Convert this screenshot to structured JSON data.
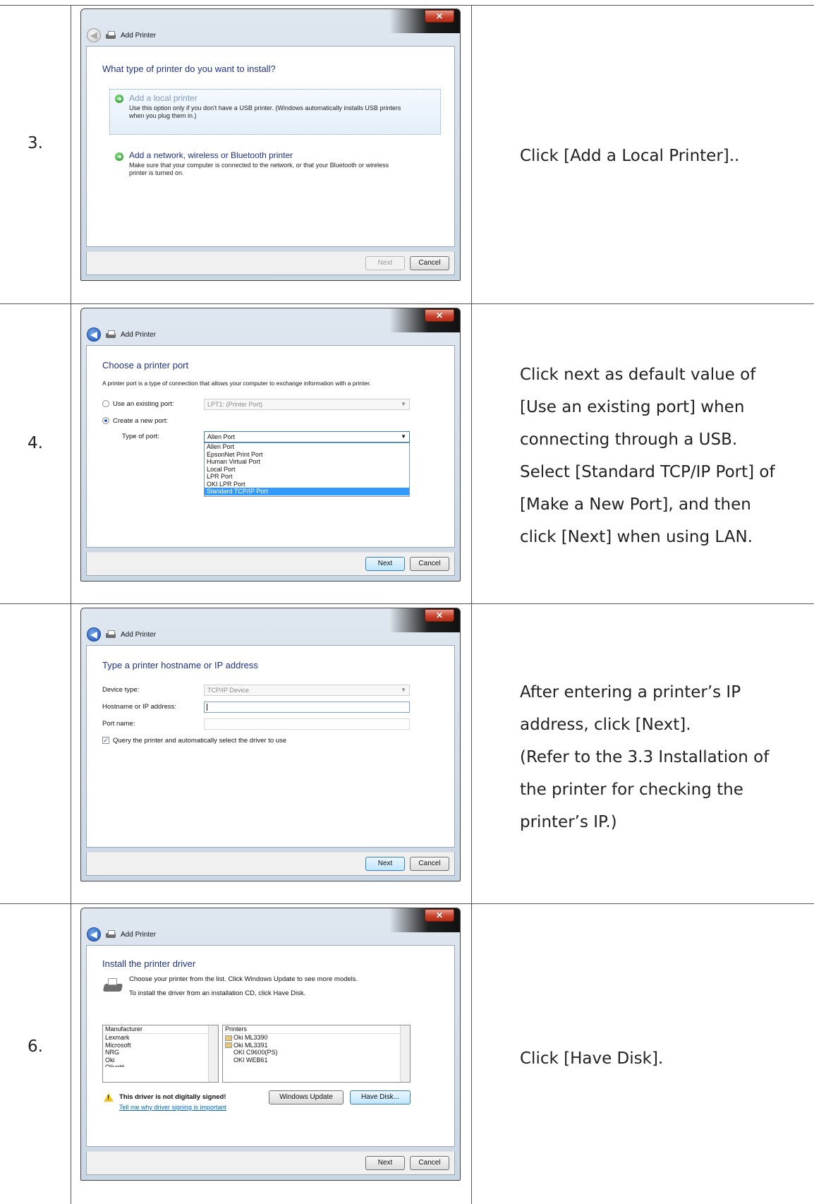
{
  "rows": [
    {
      "number": "3.",
      "instruction": [
        "Click [Add a Local Printer].."
      ],
      "dialog": {
        "title": "Add Printer",
        "heading": "What type of printer do you want to install?",
        "option1_title": "Add a local printer",
        "option1_desc1": "Use this option only if you don't have a USB printer. (Windows automatically installs USB printers",
        "option1_desc2": "when you plug them in.)",
        "option2_title": "Add a network, wireless or Bluetooth printer",
        "option2_desc1": "Make sure that your computer is connected to the network, or that your Bluetooth or wireless",
        "option2_desc2": "printer is turned on.",
        "next_label": "Next",
        "cancel_label": "Cancel"
      }
    },
    {
      "number": "4.",
      "instruction": [
        "Click next as default value of",
        "[Use an existing port] when",
        "connecting through a USB.",
        "Select   [Standard TCP/IP Port] of",
        "[Make a New Port], and then",
        "click [Next] when using LAN."
      ],
      "dialog": {
        "title": "Add Printer",
        "heading": "Choose a printer port",
        "description": "A printer port is a type of connection that allows your computer to exchange information with a printer.",
        "existing_port_label": "Use an existing port:",
        "existing_port_value": "LPT1: (Printer Port)",
        "new_port_label": "Create a new port:",
        "type_of_port_label": "Type of port:",
        "type_of_port_value": "Allen Port",
        "port_options": [
          "Allen Port",
          "EpsonNet Print Port",
          "Human Virtual Port",
          "Local Port",
          "LPR Port",
          "OKI LPR Port",
          "Standard TCP/IP Port"
        ],
        "next_label": "Next",
        "cancel_label": "Cancel"
      }
    },
    {
      "number": "",
      "instruction": [
        "After entering a printer’s IP",
        "address, click [Next].",
        "(Refer to the 3.3 Installation of",
        "the printer for checking the",
        "printer’s IP.)"
      ],
      "dialog": {
        "title": "Add Printer",
        "heading": "Type a printer hostname or IP address",
        "device_type_label": "Device type:",
        "device_type_value": "TCP/IP Device",
        "hostname_label": "Hostname or IP address:",
        "hostname_value": "",
        "port_name_label": "Port name:",
        "port_name_value": "",
        "query_label": "Query the printer and automatically select the driver to use",
        "next_label": "Next",
        "cancel_label": "Cancel"
      }
    },
    {
      "number": "6.",
      "instruction": [
        "Click [Have Disk]."
      ],
      "dialog": {
        "title": "Add Printer",
        "heading": "Install the printer driver",
        "desc1": "Choose your printer from the list. Click Windows Update to see more models.",
        "desc2": "To install the driver from an installation CD, click Have Disk.",
        "manufacturer_header": "Manufacturer",
        "manufacturers": [
          "Lexmark",
          "Microsoft",
          "NRG",
          "Oki",
          "Olivetti"
        ],
        "printers_header": "Printers",
        "printers": [
          "Oki ML3390",
          "Oki ML3391",
          "OKI C9600(PS)",
          "OKI WEB61"
        ],
        "warning": "This driver is not digitally signed!",
        "warning_link": "Tell me why driver signing is important",
        "windows_update_label": "Windows Update",
        "have_disk_label": "Have Disk...",
        "next_label": "Next",
        "cancel_label": "Cancel"
      }
    }
  ]
}
